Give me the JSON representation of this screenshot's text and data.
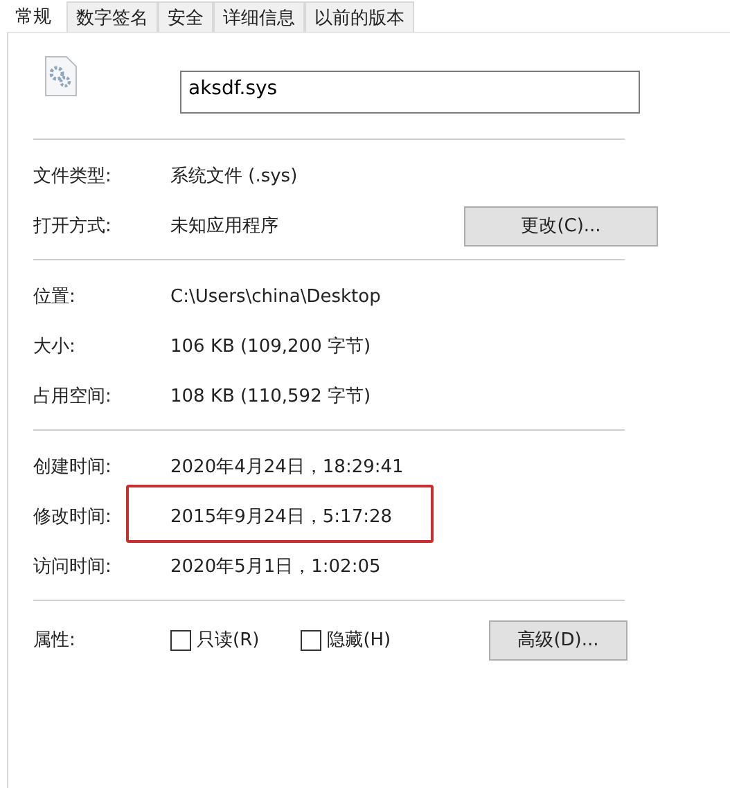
{
  "tabs": [
    {
      "label": "常规",
      "selected": true
    },
    {
      "label": "数字签名",
      "selected": false
    },
    {
      "label": "安全",
      "selected": false
    },
    {
      "label": "详细信息",
      "selected": false
    },
    {
      "label": "以前的版本",
      "selected": false
    }
  ],
  "file_name": "aksdf.sys",
  "type_section": [
    {
      "label": "文件类型:",
      "value": "系统文件 (.sys)"
    },
    {
      "label": "打开方式:",
      "value": "未知应用程序",
      "button": "更改(C)..."
    }
  ],
  "location_section": [
    {
      "label": "位置:",
      "value": "C:\\Users\\china\\Desktop"
    },
    {
      "label": "大小:",
      "value": "106 KB (109,200 字节)"
    },
    {
      "label": "占用空间:",
      "value": "108 KB (110,592 字节)"
    }
  ],
  "time_section": [
    {
      "label": "创建时间:",
      "value": "2020年4月24日，18:29:41",
      "highlighted": false
    },
    {
      "label": "修改时间:",
      "value": "2015年9月24日，5:17:28",
      "highlighted": true
    },
    {
      "label": "访问时间:",
      "value": "2020年5月1日，1:02:05",
      "highlighted": false
    }
  ],
  "attributes": {
    "label": "属性:",
    "checkboxes": [
      {
        "label": "只读(R)",
        "checked": false
      },
      {
        "label": "隐藏(H)",
        "checked": false
      }
    ],
    "button": "高级(D)..."
  }
}
